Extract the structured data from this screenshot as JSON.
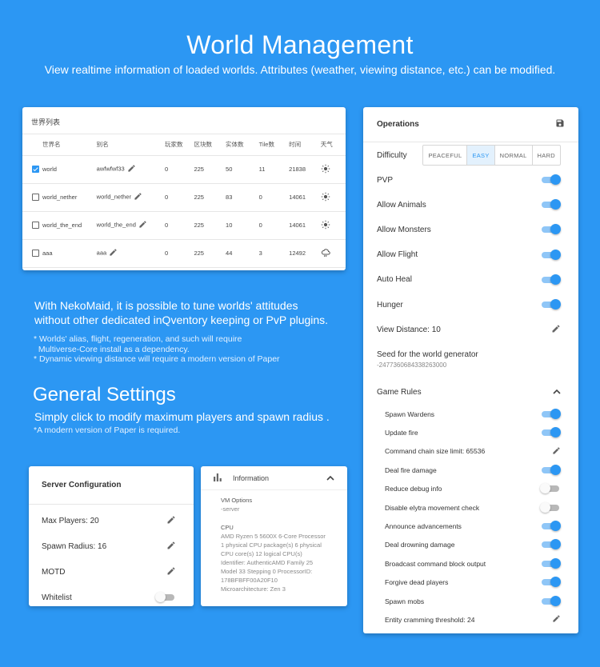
{
  "hero": {
    "title": "World Management",
    "subtitle": "View realtime information of loaded worlds. Attributes (weather, viewing distance, etc.) can be modified."
  },
  "world_list": {
    "title": "世界列表",
    "columns": [
      "世界名",
      "别名",
      "玩家数",
      "区块数",
      "实体数",
      "Tile数",
      "时间",
      "天气"
    ],
    "rows": [
      {
        "checked": true,
        "name": "world",
        "alias": "awfwfwf33",
        "players": "0",
        "chunks": "225",
        "entities": "50",
        "tiles": "11",
        "time": "21838",
        "weather": "sun-icon"
      },
      {
        "checked": false,
        "name": "world_nether",
        "alias": "world_nether",
        "players": "0",
        "chunks": "225",
        "entities": "83",
        "tiles": "0",
        "time": "14061",
        "weather": "sun-icon"
      },
      {
        "checked": false,
        "name": "world_the_end",
        "alias": "world_the_end",
        "players": "0",
        "chunks": "225",
        "entities": "10",
        "tiles": "0",
        "time": "14061",
        "weather": "sun-icon"
      },
      {
        "checked": false,
        "name": "aaa",
        "alias": "aaa",
        "players": "0",
        "chunks": "225",
        "entities": "44",
        "tiles": "3",
        "time": "12492",
        "weather": "rain-cloud-icon"
      }
    ]
  },
  "feature": {
    "line1": "With NekoMaid, it is possible to tune worlds' attitudes",
    "line2": "without other dedicated inQventory keeping or PvP plugins.",
    "note1": "* Worlds' alias, flight, regeneration, and such will require",
    "note2": "  Multiverse-Core install as a dependency.",
    "note3": "* Dynamic viewing distance will require a modern version of Paper"
  },
  "general": {
    "title": "General Settings",
    "subtitle": "Simply click to modify maximum players and spawn radius .",
    "note": "*A modern version of Paper is required."
  },
  "server_config": {
    "title": "Server Configuration",
    "max_players": "Max Players: 20",
    "spawn_radius": "Spawn Radius: 16",
    "motd": "MOTD",
    "whitelist": "Whitelist",
    "whitelist_on": false
  },
  "information": {
    "title": "Information",
    "vm_options_label": "VM Options",
    "vm_options_value": "-server",
    "cpu_label": "CPU",
    "cpu_lines": [
      "AMD Ryzen 5 5600X 6-Core Processor",
      "1 physical CPU package(s) 6 physical",
      "CPU core(s) 12 logical CPU(s)",
      "Identifier: AuthenticAMD Family 25",
      "Model 33 Stepping 0 ProcessorID:",
      "178BFBFF00A20F10",
      "Microarchitecture: Zen 3"
    ]
  },
  "operations": {
    "title": "Operations",
    "difficulty_label": "Difficulty",
    "difficulty_options": [
      "PEACEFUL",
      "EASY",
      "NORMAL",
      "HARD"
    ],
    "difficulty_selected": "EASY",
    "toggles": [
      {
        "label": "PVP",
        "on": true
      },
      {
        "label": "Allow Animals",
        "on": true
      },
      {
        "label": "Allow Monsters",
        "on": true
      },
      {
        "label": "Allow Flight",
        "on": true
      },
      {
        "label": "Auto Heal",
        "on": true
      },
      {
        "label": "Hunger",
        "on": true
      }
    ],
    "view_distance": "View Distance: 10",
    "seed_label": "Seed for the world generator",
    "seed_value": "-2477360684338263000",
    "game_rules_title": "Game Rules",
    "game_rules": [
      {
        "label": "Spawn Wardens",
        "type": "toggle",
        "on": true
      },
      {
        "label": "Update fire",
        "type": "toggle",
        "on": true
      },
      {
        "label": "Command chain size limit: 65536",
        "type": "edit"
      },
      {
        "label": "Deal fire damage",
        "type": "toggle",
        "on": true
      },
      {
        "label": "Reduce debug info",
        "type": "toggle",
        "on": false
      },
      {
        "label": "Disable elytra movement check",
        "type": "toggle",
        "on": false
      },
      {
        "label": "Announce advancements",
        "type": "toggle",
        "on": true
      },
      {
        "label": "Deal drowning damage",
        "type": "toggle",
        "on": true
      },
      {
        "label": "Broadcast command block output",
        "type": "toggle",
        "on": true
      },
      {
        "label": "Forgive dead players",
        "type": "toggle",
        "on": true
      },
      {
        "label": "Spawn mobs",
        "type": "toggle",
        "on": true
      },
      {
        "label": "Entity cramming threshold: 24",
        "type": "edit"
      }
    ]
  },
  "colors": {
    "background": "#2c97f3",
    "accent": "#2c97f3",
    "card": "#ffffff"
  }
}
